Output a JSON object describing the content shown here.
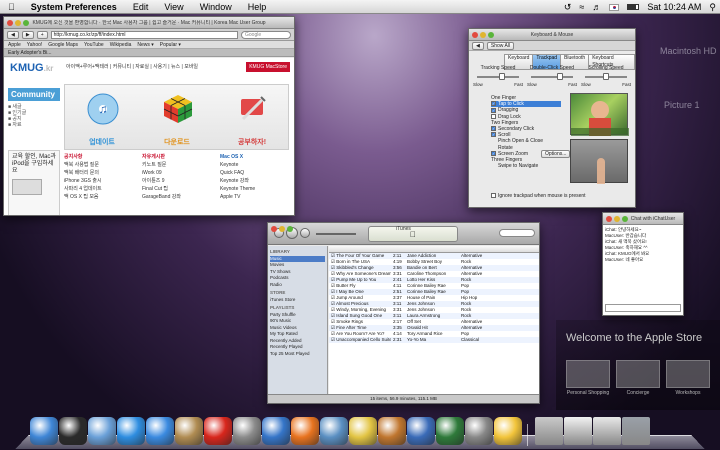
{
  "menubar": {
    "app": "System Preferences",
    "items": [
      "Edit",
      "View",
      "Window",
      "Help"
    ],
    "clock": "Sat 10:24 AM"
  },
  "safari": {
    "title": "KMUG에 오신 것을 환영합니다 · 한국 Mac 사용자 그룹 | 쉽고 즐거운 · Mac 커뮤니티 | Korea Mac User Group",
    "url": "http://kmug.co.kr/zp/ff/index.html",
    "search_placeholder": "Google",
    "bookmarks": [
      "Apple",
      "Yahoo!",
      "Google Maps",
      "YouTube",
      "Wikipedia",
      "News ▾",
      "Popular ▾"
    ],
    "tab": "Early Adopter's Bi...",
    "site": {
      "logo": "KMUG",
      "logo_sub": ".kr",
      "nav": "아이맥+루어+맥테러 | 커뮤니티 | 자료실 | 사용기 | 뉴스 | 모바일",
      "badge": "KMUG MacStore",
      "community": "Community",
      "ad_text": "교육 할인, Mac과 iPod을 구입하세요",
      "promos": [
        {
          "label": "업데이트",
          "color": "#4aa3df"
        },
        {
          "label": "다운로드",
          "color": "#e8a020"
        },
        {
          "label": "공부하자!",
          "color": "#d43c3c"
        }
      ],
      "news": [
        [
          "공지사항",
          "맥북 사용법 질문",
          "맥북 배터리 문의",
          "iPhone 3GS 출시",
          "사파리 4 업데이트",
          "맥 OS X 팁 모음"
        ],
        [
          "자유게시판",
          "키노트 질문",
          "iWork 09",
          "아이튠즈 9",
          "Final Cut 팁",
          "GarageBand 강좌"
        ],
        [
          "Mac OS X",
          "Keynote",
          "Quick FAQ",
          "Keynote 강좌",
          "Keynote Theme",
          "Apple TV"
        ]
      ]
    }
  },
  "kbm": {
    "title": "Keyboard & Mouse",
    "show_all": "Show All",
    "tabs": [
      "Keyboard",
      "Trackpad",
      "Bluetooth",
      "Keyboard Shortcuts"
    ],
    "active_tab": "Trackpad",
    "speeds": [
      {
        "label": "Tracking Speed",
        "min": "Slow",
        "max": "Fast"
      },
      {
        "label": "Double-Click Speed",
        "min": "Slow",
        "max": "Fast"
      },
      {
        "label": "Scrolling Speed",
        "min": "Slow",
        "max": "Fast"
      }
    ],
    "one_finger": "One Finger",
    "opts1": [
      "Tap to Click",
      "Dragging",
      "Drag Lock"
    ],
    "two_fingers": "Two Fingers",
    "opts2": [
      "Secondary Click",
      "Scroll",
      "Pinch Open & Close",
      "Rotate",
      "Screen Zoom"
    ],
    "options_button": "Options...",
    "three_fingers": "Three Fingers",
    "swipe": "Swipe to Navigate",
    "ignore": "Ignore trackpad when mouse is present"
  },
  "itunes": {
    "title": "iTunes",
    "library_header": "LIBRARY",
    "library": [
      "Music",
      "Movies",
      "TV Shows",
      "Podcasts",
      "Radio"
    ],
    "store_header": "STORE",
    "store": [
      "iTunes Store"
    ],
    "playlists_header": "PLAYLISTS",
    "playlists": [
      "Party Shuffle",
      "90's Music",
      "Music Videos",
      "My Top Rated",
      "Recently Added",
      "Recently Played",
      "Top 25 Most Played"
    ],
    "songs": [
      [
        "The Four Of Your Game",
        "2:11",
        "Jane Addiction",
        "Alternative"
      ],
      [
        "Born in The USA",
        "4:19",
        "Bobby Street Boy",
        "Rock"
      ],
      [
        "Skibbled's Change",
        "3:56",
        "Bandie on Bert",
        "Alternative"
      ],
      [
        "Why Are Someone's Dream",
        "3:31",
        "Caroline Thompson",
        "Alternative"
      ],
      [
        "Pump Me Up to You",
        "2:41",
        "Lotto Her Kiss",
        "Rock"
      ],
      [
        "Butter Fly",
        "4:11",
        "Corinne Bailey Rae",
        "Pop"
      ],
      [
        "I May Be One",
        "2:51",
        "Corinne Bailey Rae",
        "Pop"
      ],
      [
        "Jump Around",
        "3:37",
        "House of Pain",
        "Hip Hop"
      ],
      [
        "Almost Precious",
        "3:11",
        "Jens Johnson",
        "Rock"
      ],
      [
        "Windy, Morning, Evening",
        "3:31",
        "Jens Johnson",
        "Rock"
      ],
      [
        "Island Sung Good One",
        "3:11",
        "Laura Armstrong",
        "Rock"
      ],
      [
        "Smoke Rings",
        "2:17",
        "Off Set",
        "Alternative"
      ],
      [
        "Fine After Time",
        "3:35",
        "Osvald Hit",
        "Alternative"
      ],
      [
        "Are You Room? Are Yo?",
        "4:14",
        "Tory Armand Rice",
        "Pop"
      ],
      [
        "Unaccompanied Cello Suite No.1",
        "2:31",
        "Yo-Yo Ma",
        "Classical"
      ]
    ],
    "status": "15 items, 56.9 minutes, 115.1 MB"
  },
  "ichat": {
    "title": "Chat with iChatUser",
    "lines": [
      "iChat: 안녕하세요~",
      "MacUser: 반갑습니다",
      "iChat: 새 맥북 샀어요!",
      "MacUser: 축하해요 ^^",
      "iChat: KMUG에서 봐요",
      "MacUser: 네 좋아요"
    ]
  },
  "behind": {
    "hd_label": "Macintosh HD",
    "screenshot_label": "Picture 1",
    "store_title": "Welcome to the Apple Store",
    "store_tiles": [
      "Personal Shopping",
      "Concierge",
      "Workshops"
    ]
  },
  "dock": {
    "apps": [
      {
        "name": "finder",
        "color": "#3f86d6"
      },
      {
        "name": "dashboard",
        "color": "#2b2b2b"
      },
      {
        "name": "mail",
        "color": "#6aa0d8"
      },
      {
        "name": "safari",
        "color": "#2e8de0"
      },
      {
        "name": "ichat",
        "color": "#3a8ae0"
      },
      {
        "name": "address-book",
        "color": "#b08c52"
      },
      {
        "name": "ical",
        "color": "#d8261c"
      },
      {
        "name": "preview",
        "color": "#8b8b8b"
      },
      {
        "name": "itunes",
        "color": "#3575c8"
      },
      {
        "name": "firefox",
        "color": "#e8731f"
      },
      {
        "name": "iphoto",
        "color": "#5a8fc2"
      },
      {
        "name": "imovie",
        "color": "#e2c443"
      },
      {
        "name": "garageband",
        "color": "#c0762e"
      },
      {
        "name": "spaces",
        "color": "#3a6bb8"
      },
      {
        "name": "time-machine",
        "color": "#2e7a3a"
      },
      {
        "name": "system-preferences",
        "color": "#888888"
      },
      {
        "name": "adium",
        "color": "#f2c43a"
      }
    ],
    "right": [
      {
        "name": "applications-stack",
        "color": "#c9c9c9"
      },
      {
        "name": "documents-stack",
        "color": "#f2f2f2"
      },
      {
        "name": "downloads-stack",
        "color": "#e8e8e8"
      },
      {
        "name": "trash",
        "color": "#9aa0a8"
      }
    ]
  }
}
